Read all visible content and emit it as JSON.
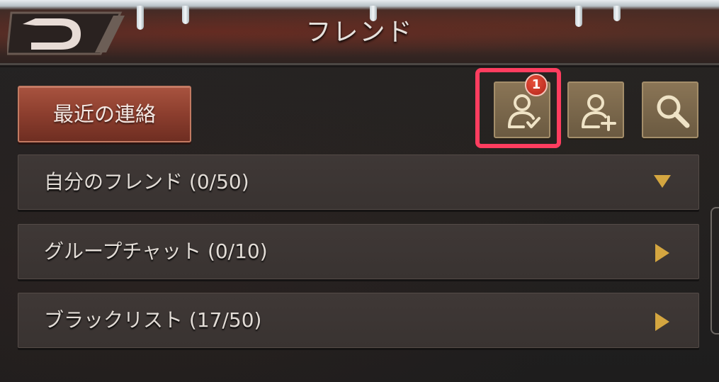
{
  "header": {
    "title": "フレンド",
    "back_icon": "back-arrow-icon"
  },
  "toolbar": {
    "recent_label": "最近の連絡",
    "friend_requests": {
      "icon": "friend-request-check-icon",
      "badge_count": "1"
    },
    "add_friend": {
      "icon": "add-friend-icon"
    },
    "search": {
      "icon": "search-icon"
    }
  },
  "lists": [
    {
      "label": "自分のフレンド (0/50)",
      "arrow": "triangle-down-icon"
    },
    {
      "label": "グループチャット (0/10)",
      "arrow": "triangle-right-icon"
    },
    {
      "label": "ブラックリスト (17/50)",
      "arrow": "triangle-right-icon"
    }
  ],
  "colors": {
    "highlight": "#ff3d5f",
    "accent_gold": "#d4a640",
    "recent_button": "#8c3e2e"
  }
}
